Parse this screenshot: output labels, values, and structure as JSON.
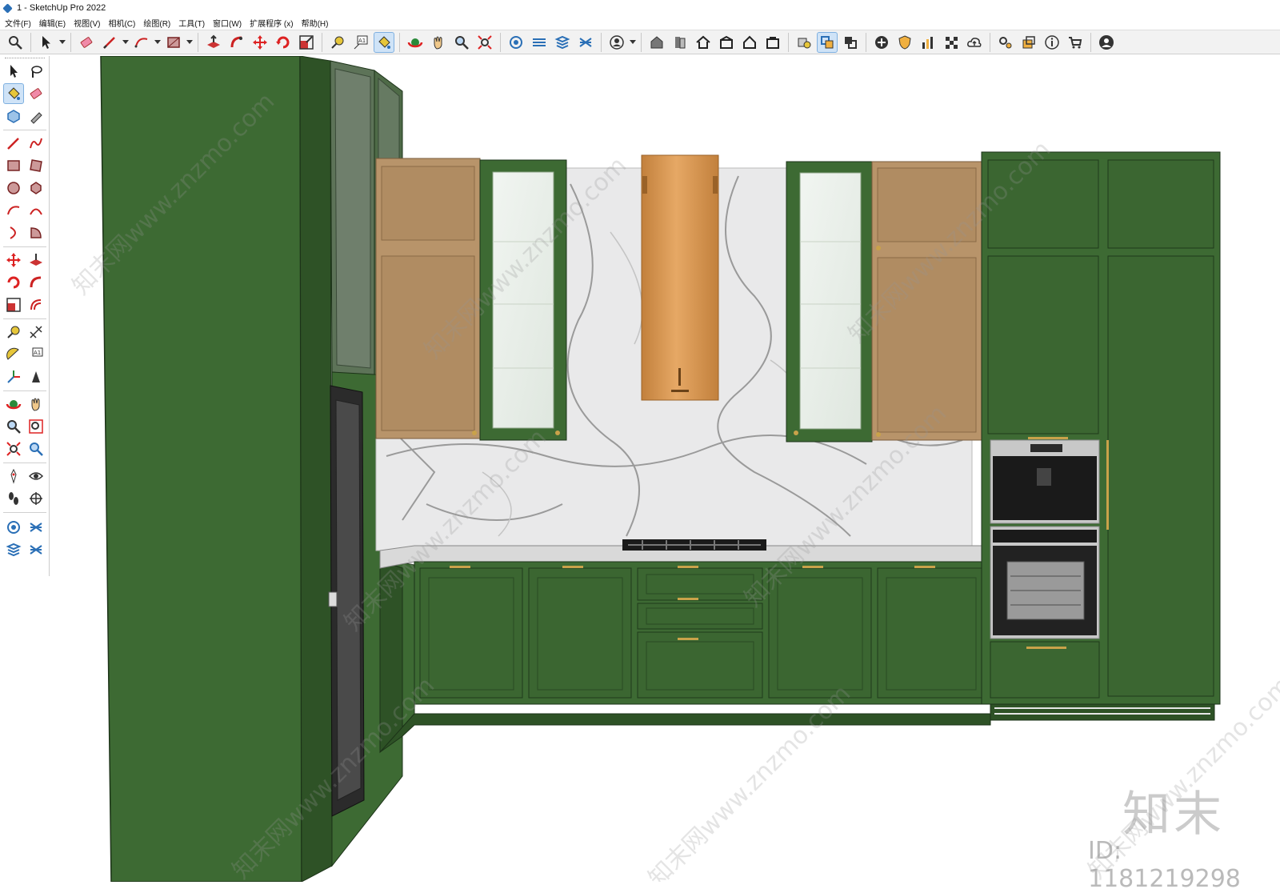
{
  "window": {
    "title": "1 - SketchUp Pro 2022"
  },
  "menu": [
    "文件(F)",
    "编辑(E)",
    "视图(V)",
    "相机(C)",
    "绘图(R)",
    "工具(T)",
    "窗口(W)",
    "扩展程序 (x)",
    "帮助(H)"
  ],
  "toolbar": {
    "text_tool_label": "A1",
    "icons": [
      "zoom-icon",
      "select-icon",
      "eraser-icon",
      "pencil-line-icon",
      "arc-icon",
      "rectangle-icon",
      "push-pull-icon",
      "follow-me-icon",
      "move-icon",
      "rotate-icon",
      "scale-icon",
      "tape-measure-icon",
      "text-icon",
      "paint-bucket-icon",
      "orbit-icon",
      "pan-icon",
      "zoom-tool-icon",
      "zoom-extents-icon",
      "section-plane-icon",
      "display-section-icon",
      "tag-icon",
      "layers-icon",
      "profile-icon",
      "warehouse-icon",
      "component-icon",
      "home-icon",
      "box-house-icon",
      "outline-house-icon",
      "share-icon",
      "solid-tools-icon",
      "outer-shell-icon",
      "intersect-icon",
      "add-location-icon",
      "shield-icon",
      "chart-icon",
      "checker-icon",
      "cloud-upload-icon",
      "extension-manager-icon",
      "scenes-icon",
      "info-icon",
      "cart-icon",
      "account-icon"
    ]
  },
  "left_toolbar": {
    "text_tool_label": "A1",
    "icons": [
      "select-icon",
      "lasso-icon",
      "paint-bucket-icon",
      "eraser-icon",
      "component-icon",
      "tag-pen-icon",
      "pencil-line-icon",
      "freehand-icon",
      "rectangle-icon",
      "rotated-rectangle-icon",
      "circle-icon",
      "polygon-icon",
      "arc-icon",
      "two-point-arc-icon",
      "three-point-arc-icon",
      "pie-icon",
      "move-icon",
      "push-pull-icon",
      "rotate-icon",
      "follow-me-icon",
      "scale-icon",
      "offset-icon",
      "tape-measure-icon",
      "dimension-icon",
      "protractor-icon",
      "text-icon",
      "axes-icon",
      "3d-text-icon",
      "orbit-icon",
      "pan-icon",
      "zoom-icon",
      "zoom-window-icon",
      "zoom-extents-icon",
      "previous-view-icon",
      "position-camera-icon",
      "look-around-icon",
      "walk-icon",
      "section-plane-icon",
      "display-section-icon",
      "section-cut-icon",
      "section-fill-icon",
      "layers-icon"
    ]
  },
  "scene": {
    "description_colors": {
      "cabinet_green": "#3f6b34",
      "cabinet_dark_green": "#2f5226",
      "upper_tan": "#b8946a",
      "hood_copper": "#d4924a",
      "marble": "#e9e9ea",
      "countertop": "#d9d9d9",
      "handle_gold": "#c9a24a",
      "appliance_dark": "#1a1a1a",
      "appliance_steel": "#c8c8c8"
    }
  },
  "watermark": {
    "logo": "知末",
    "id_text": "ID: 1181219298",
    "diagonal_text": "知末网www.znzmo.com"
  }
}
